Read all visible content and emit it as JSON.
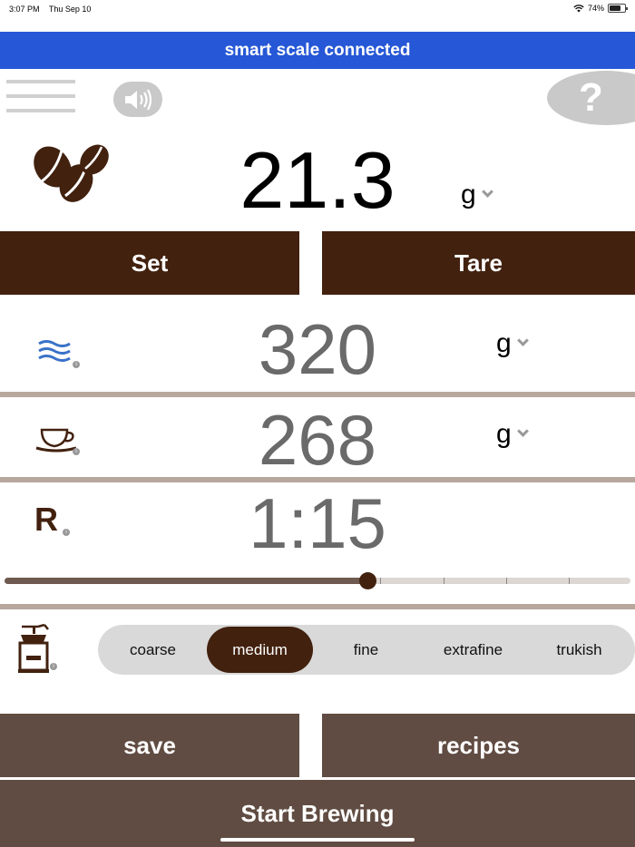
{
  "status": {
    "time": "3:07 PM",
    "date": "Thu Sep 10",
    "battery": "74%",
    "battery_level": 0.74
  },
  "banner": {
    "text": "smart scale connected"
  },
  "toolbar": {
    "menu_icon": "hamburger-icon",
    "sound_icon": "speaker-icon",
    "help_symbol": "?"
  },
  "coffee": {
    "icon": "coffee-beans-icon",
    "value": "21.3",
    "unit": "g"
  },
  "buttons": {
    "set": "Set",
    "tare": "Tare",
    "save": "save",
    "recipes": "recipes",
    "start": "Start Brewing"
  },
  "water": {
    "icon": "water-waves-icon",
    "value": "320",
    "unit": "g"
  },
  "cup": {
    "icon": "coffee-cup-icon",
    "value": "268",
    "unit": "g"
  },
  "ratio": {
    "letter": "R",
    "value": "1:15",
    "slider_fraction": 0.58
  },
  "grind": {
    "icon": "coffee-grinder-icon",
    "options": [
      "coarse",
      "medium",
      "fine",
      "extrafine",
      "trukish"
    ],
    "selected": "medium"
  },
  "colors": {
    "banner": "#2557d6",
    "brown_dark": "#42210f",
    "brown_muted": "#604c42",
    "divider": "#b7a79d"
  }
}
